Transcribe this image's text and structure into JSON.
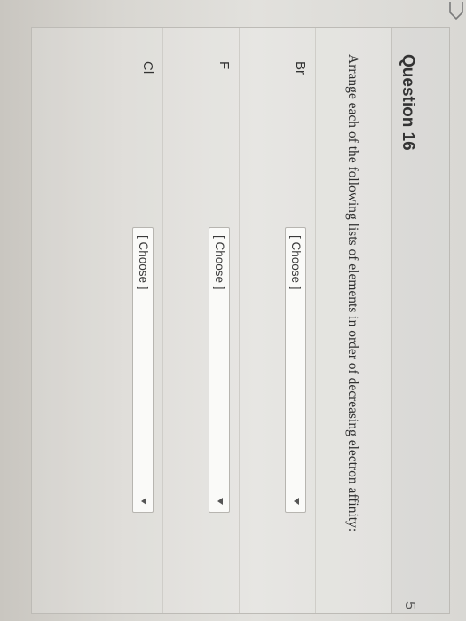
{
  "question": {
    "title": "Question 16",
    "points": "5",
    "prompt": "Arrange each of the following lists of elements in order of decreasing electron affinity:"
  },
  "rows": [
    {
      "label": "Br",
      "select_value": "[ Choose ]"
    },
    {
      "label": "F",
      "select_value": "[ Choose ]"
    },
    {
      "label": "Cl",
      "select_value": "[ Choose ]"
    }
  ],
  "icons": {
    "corner": "arrow-outline-icon",
    "dropdown": "triangle-down-icon"
  }
}
